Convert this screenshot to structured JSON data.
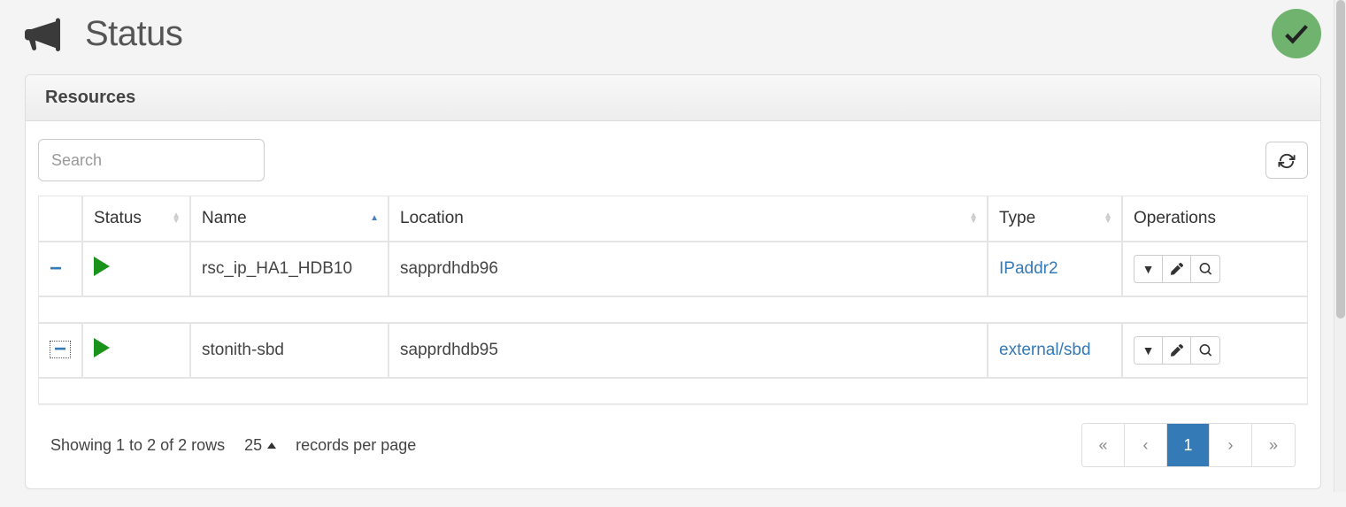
{
  "header": {
    "title": "Status"
  },
  "panel": {
    "heading": "Resources",
    "search_placeholder": "Search"
  },
  "columns": {
    "status": "Status",
    "name": "Name",
    "location": "Location",
    "type": "Type",
    "operations": "Operations"
  },
  "rows": [
    {
      "name": "rsc_ip_HA1_HDB10",
      "location": "sapprdhdb96",
      "type": "IPaddr2"
    },
    {
      "name": "stonith-sbd",
      "location": "sapprdhdb95",
      "type": "external/sbd"
    }
  ],
  "footer": {
    "showing": "Showing 1 to 2 of 2 rows",
    "page_size": "25",
    "records_label": "records per page",
    "pages": {
      "first": "«",
      "prev": "‹",
      "current": "1",
      "next": "›",
      "last": "»"
    }
  }
}
